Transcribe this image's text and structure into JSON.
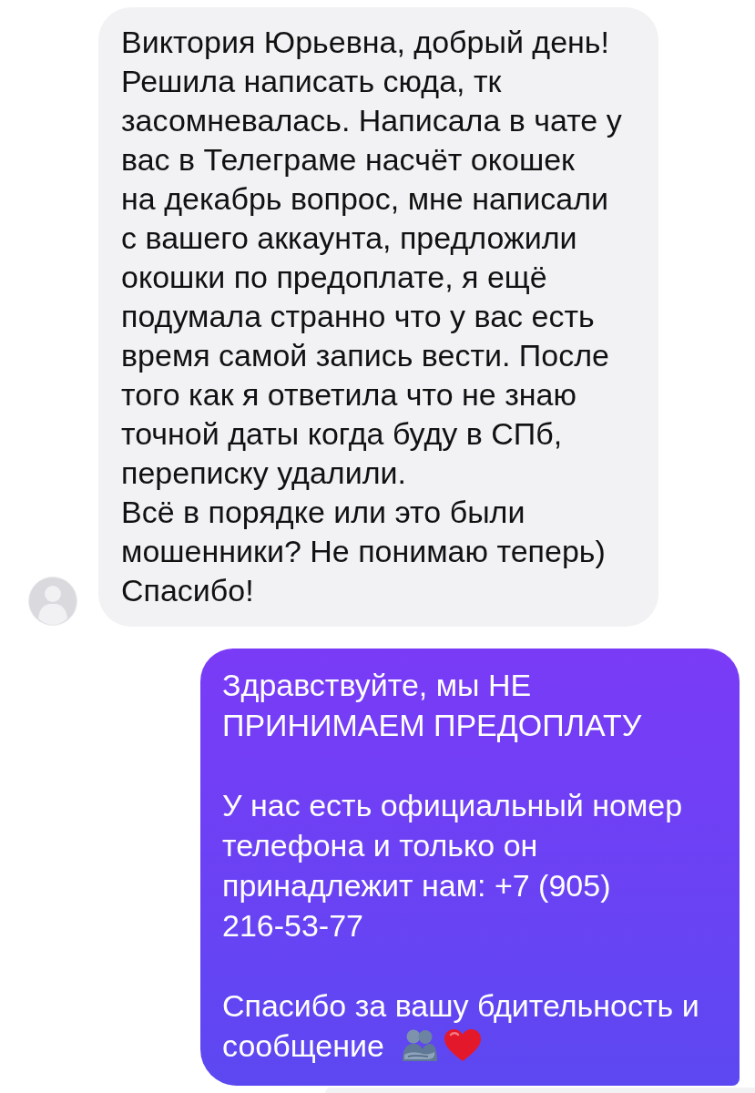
{
  "messages": [
    {
      "kind": "incoming",
      "paragraphs": [
        {
          "lines": [
            "Виктория Юрьевна, добрый день!",
            "Решила написать сюда, тк",
            "засомневалась. Написала в чате у",
            "вас в Телеграме насчёт окошек",
            "на декабрь вопрос, мне написали",
            "с вашего аккаунта, предложили",
            "окошки по предоплате, я ещё",
            "подумала странно что у вас есть",
            "время самой запись вести. После",
            "того как я ответила что не знаю",
            "точной даты когда буду в СПб,",
            "переписку удалили."
          ]
        },
        {
          "lines": [
            "Всё в порядке или это были",
            "мошенники? Не понимаю теперь)"
          ]
        },
        {
          "lines": [
            "Спасибо!"
          ]
        }
      ]
    },
    {
      "kind": "outgoing",
      "paragraphs": [
        {
          "lines": [
            "Здравствуйте, мы НЕ",
            "ПРИНИМАЕМ ПРЕДОПЛАТУ"
          ]
        },
        {
          "lines": [
            "У нас есть официальный номер",
            "телефона и только он",
            "принадлежит нам: +7 (905)",
            "216-53-77"
          ]
        },
        {
          "lines": [
            "Спасибо за вашу бдительность и",
            "сообщение"
          ]
        }
      ]
    }
  ]
}
